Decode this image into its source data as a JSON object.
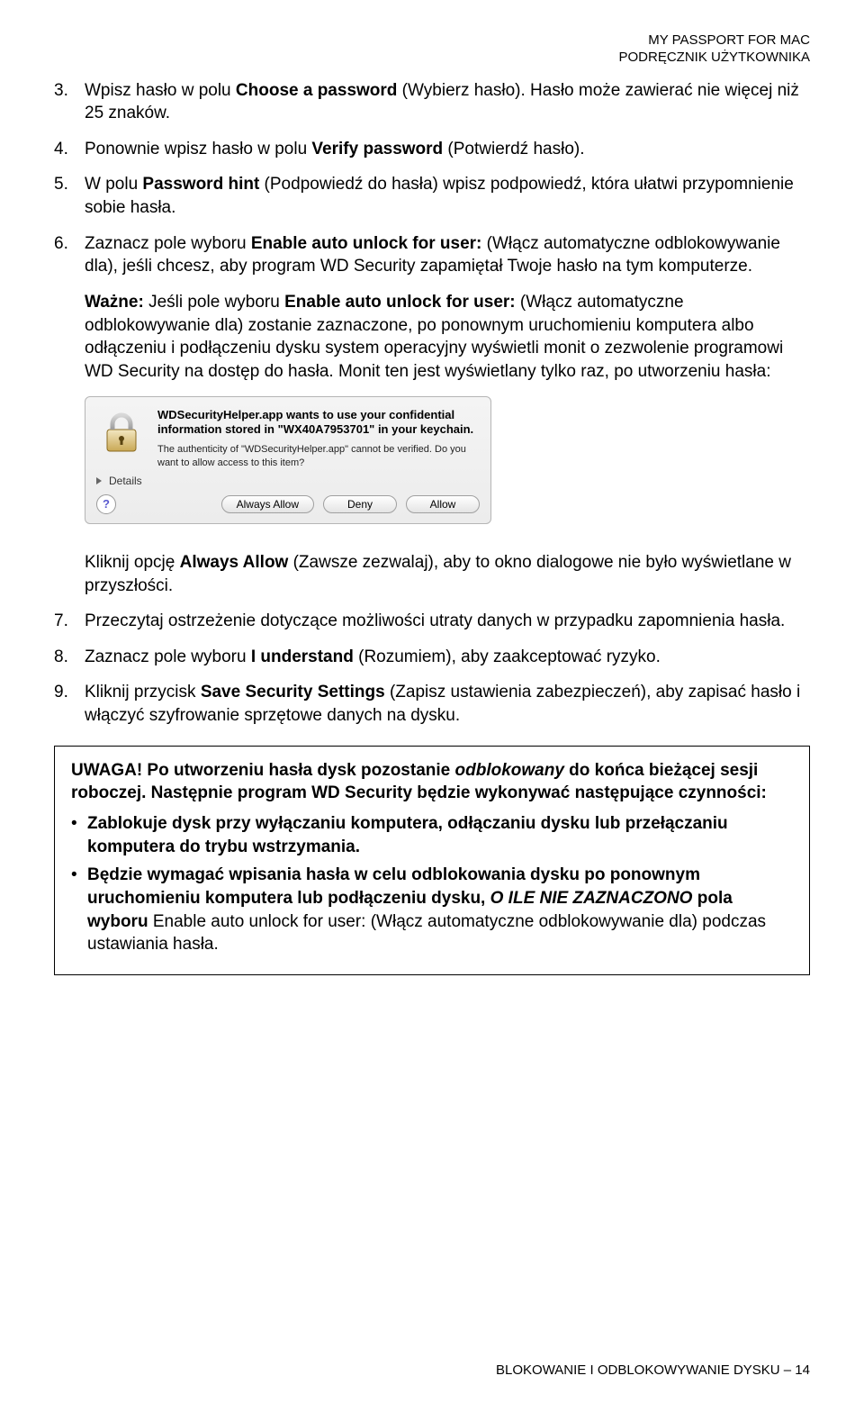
{
  "header": {
    "line1": "MY PASSPORT FOR MAC",
    "line2": "PODRĘCZNIK UŻYTKOWNIKA"
  },
  "items": {
    "n3": "3.",
    "t3a": "Wpisz hasło w polu ",
    "t3b": "Choose a password",
    "t3c": " (Wybierz hasło). Hasło może zawierać nie więcej niż 25 znaków.",
    "n4": "4.",
    "t4a": "Ponownie wpisz hasło w polu ",
    "t4b": "Verify password",
    "t4c": " (Potwierdź hasło).",
    "n5": "5.",
    "t5a": "W polu ",
    "t5b": "Password hint",
    "t5c": " (Podpowiedź do hasła) wpisz podpowiedź, która ułatwi przypomnienie sobie hasła.",
    "n6": "6.",
    "t6a": "Zaznacz pole wyboru ",
    "t6b": "Enable auto unlock for user:",
    "t6c": " (Włącz automatyczne odblokowywanie dla), jeśli chcesz, aby program WD Security zapamiętał Twoje hasło na tym komputerze.",
    "impA": "Ważne:",
    "impB": " Jeśli pole wyboru ",
    "impC": "Enable auto unlock for user:",
    "impD": " (Włącz automatyczne odblokowywanie dla) zostanie zaznaczone, po ponownym uruchomieniu komputera albo odłączeniu i podłączeniu dysku system operacyjny wyświetli monit o zezwolenie programowi WD Security na dostęp do hasła. Monit ten jest wyświetlany tylko raz, po utworzeniu hasła:",
    "afterDlgA": "Kliknij opcję ",
    "afterDlgB": "Always Allow",
    "afterDlgC": " (Zawsze zezwalaj), aby to okno dialogowe nie było wyświetlane w przyszłości.",
    "n7": "7.",
    "t7": "Przeczytaj ostrzeżenie dotyczące możliwości utraty danych w przypadku zapomnienia hasła.",
    "n8": "8.",
    "t8a": "Zaznacz pole wyboru ",
    "t8b": "I understand",
    "t8c": " (Rozumiem), aby zaakceptować ryzyko.",
    "n9": "9.",
    "t9a": "Kliknij przycisk ",
    "t9b": "Save Security Settings",
    "t9c": " (Zapisz ustawienia zabezpieczeń), aby zapisać hasło i włączyć szyfrowanie sprzętowe danych na dysku."
  },
  "dialog": {
    "bold": "WDSecurityHelper.app wants to use your confidential information stored in \"WX40A7953701\" in your keychain.",
    "sub": "The authenticity of \"WDSecurityHelper.app\" cannot be verified. Do you want to allow access to this item?",
    "details": "Details",
    "alwaysAllow": "Always Allow",
    "deny": "Deny",
    "allow": "Allow"
  },
  "note": {
    "p1a": "UWAGA!  Po utworzeniu hasła dysk pozostanie ",
    "p1b": "odblokowany",
    "p1c": " do końca bieżącej sesji roboczej. Następnie program WD Security będzie wykonywać następujące czynności:",
    "b1": "Zablokuje dysk przy wyłączaniu komputera, odłączaniu dysku lub przełączaniu komputera do trybu wstrzymania.",
    "b2a": "Będzie wymagać wpisania hasła w celu odblokowania dysku po ponownym uruchomieniu komputera lub podłączeniu dysku, ",
    "b2b": "O ILE NIE ZAZNACZONO",
    "b2c": " pola wyboru ",
    "b2d": "Enable auto unlock for user: (Włącz automatyczne odblokowywanie dla) podczas ustawiania hasła."
  },
  "footer": "BLOKOWANIE I ODBLOKOWYWANIE DYSKU – 14"
}
